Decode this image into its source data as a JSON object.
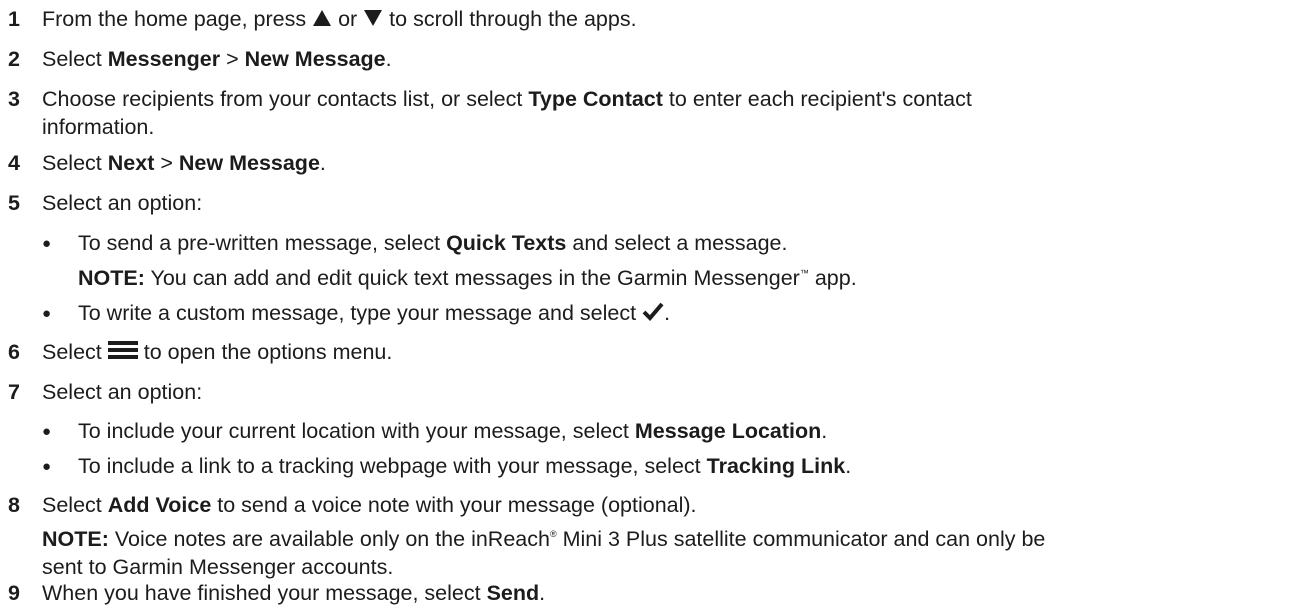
{
  "steps": [
    {
      "num": "1",
      "a": "From the home page, press",
      "b": "or",
      "c": "to scroll through the apps.",
      "icon_up": "triangle-up-icon",
      "icon_down": "triangle-down-icon"
    },
    {
      "num": "2",
      "a": "Select",
      "b1": "Messenger",
      "sep": ">",
      "b2": "New Message",
      "end": "."
    },
    {
      "num": "3",
      "a": "Choose recipients from your contacts list, or select",
      "b": "Type Contact",
      "c": "to enter each recipient's contact",
      "line2": "information."
    },
    {
      "num": "4",
      "a": "Select",
      "b1": "Next",
      "sep": ">",
      "b2": "New Message",
      "end": "."
    },
    {
      "num": "5",
      "text": "Select an option:",
      "bullets": [
        {
          "a": "To send a pre-written message, select",
          "b": "Quick Texts",
          "c": "and select a message."
        },
        {
          "a": "To write a custom message, type your message and select",
          "end": ".",
          "icon": "checkmark-icon"
        }
      ],
      "note": {
        "label": "NOTE:",
        "a": "You can add and edit quick text messages in the Garmin Messenger",
        "tm": "™",
        "b": "app."
      }
    },
    {
      "num": "6",
      "a": "Select",
      "b": "to open the options menu.",
      "icon": "menu-icon"
    },
    {
      "num": "7",
      "text": "Select an option:",
      "bullets": [
        {
          "a": "To include your current location with your message, select",
          "b": "Message Location",
          "end": "."
        },
        {
          "a": "To include a link to a tracking webpage with your message, select",
          "b": "Tracking Link",
          "end": "."
        }
      ]
    },
    {
      "num": "8",
      "a": "Select",
      "b": "Add Voice",
      "c": "to send a voice note with your message (optional).",
      "note": {
        "label": "NOTE:",
        "a": "Voice notes are available only on the inReach",
        "reg": "®",
        "b": "Mini 3 Plus satellite communicator and can only be",
        "line2": "sent to Garmin Messenger accounts."
      }
    },
    {
      "num": "9",
      "a": "When you have finished your message, select",
      "b": "Send",
      "end": "."
    }
  ],
  "bullet_char": "●",
  "colors": {
    "text": "#1c1c1c",
    "icon": "#1c1c1c"
  }
}
